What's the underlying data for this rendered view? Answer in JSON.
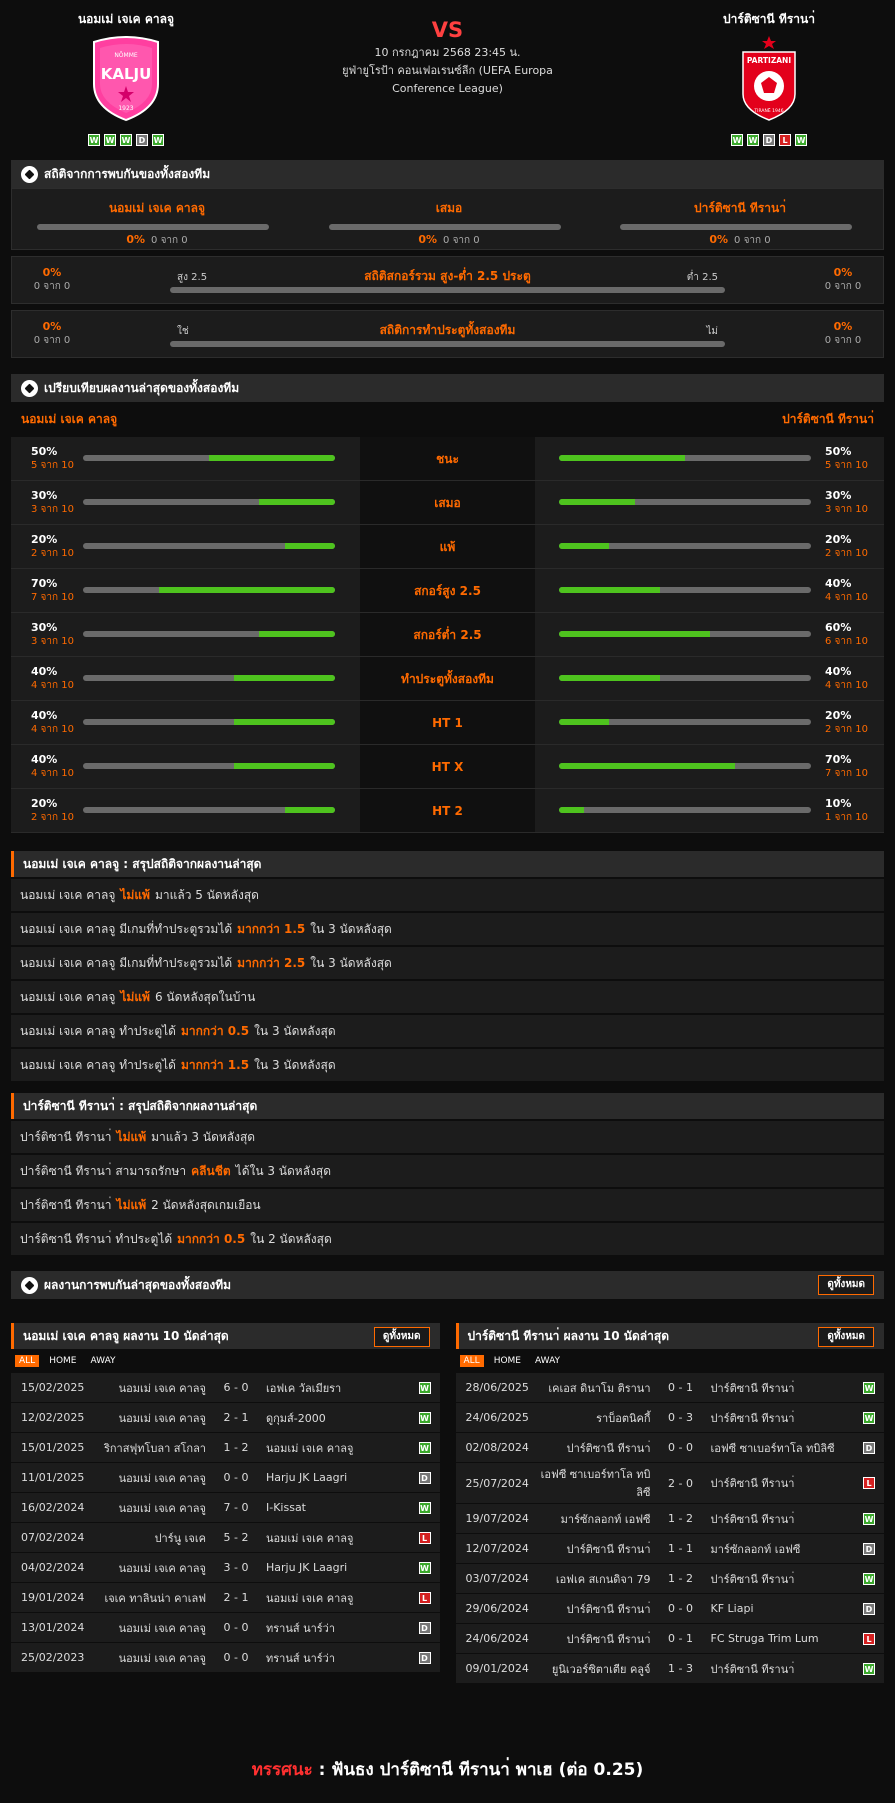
{
  "header": {
    "home_name": "นอมเม่ เจเค คาลจู",
    "away_name": "ปาร์ติซานี ทีรานา่",
    "vs": "VS",
    "match_time": "10 กรกฎาคม 2568 23:45 น.",
    "competition": "ยูฟ่ายูโรป้า คอนเฟอเรนซ์ลีก (UEFA Europa Conference League)",
    "home_form": [
      "W",
      "W",
      "W",
      "D",
      "W"
    ],
    "away_form": [
      "W",
      "W",
      "D",
      "L",
      "W"
    ],
    "home_logo_text": "KALJU",
    "home_logo_top": "NÕMME",
    "home_logo_year": "1923",
    "away_logo_text": "PARTIZANI",
    "away_logo_bottom": "TIRANË 1946"
  },
  "h2h": {
    "title": "สถิติจากการพบกันของทั้งสองทีม",
    "cols": [
      {
        "name": "นอมเม่ เจเค คาลจู",
        "pct": "0%",
        "sub": "0 จาก 0",
        "fill": 0
      },
      {
        "name": "เสมอ",
        "pct": "0%",
        "sub": "0 จาก 0",
        "fill": 0
      },
      {
        "name": "ปาร์ติซานี ทีรานา่",
        "pct": "0%",
        "sub": "0 จาก 0",
        "fill": 0
      }
    ],
    "ou": {
      "title": "สถิติสกอร์รวม สูง-ต่ำ 2.5 ประตู",
      "left_label": "สูง 2.5",
      "right_label": "ต่ำ 2.5",
      "left_pct": "0%",
      "left_sub": "0 จาก 0",
      "right_pct": "0%",
      "right_sub": "0 จาก 0"
    },
    "btts": {
      "title": "สถิติการทำประตูทั้งสองทีม",
      "left_label": "ใช่",
      "right_label": "ไม่",
      "left_pct": "0%",
      "left_sub": "0 จาก 0",
      "right_pct": "0%",
      "right_sub": "0 จาก 0"
    }
  },
  "compare": {
    "title": "เปรียบเทียบผลงานล่าสุดของทั้งสองทีม",
    "home": "นอมเม่ เจเค คาลจู",
    "away": "ปาร์ติซานี ทีรานา่",
    "rows": [
      {
        "label": "ชนะ",
        "hp": "50%",
        "hs": "5 จาก 10",
        "hf": 0.5,
        "ap": "50%",
        "as": "5 จาก 10",
        "af": 0.5
      },
      {
        "label": "เสมอ",
        "hp": "30%",
        "hs": "3 จาก 10",
        "hf": 0.3,
        "ap": "30%",
        "as": "3 จาก 10",
        "af": 0.3
      },
      {
        "label": "แพ้",
        "hp": "20%",
        "hs": "2 จาก 10",
        "hf": 0.2,
        "ap": "20%",
        "as": "2 จาก 10",
        "af": 0.2
      },
      {
        "label": "สกอร์สูง 2.5",
        "hp": "70%",
        "hs": "7 จาก 10",
        "hf": 0.7,
        "ap": "40%",
        "as": "4 จาก 10",
        "af": 0.4
      },
      {
        "label": "สกอร์ต่ำ 2.5",
        "hp": "30%",
        "hs": "3 จาก 10",
        "hf": 0.3,
        "ap": "60%",
        "as": "6 จาก 10",
        "af": 0.6
      },
      {
        "label": "ทำประตูทั้งสองทีม",
        "hp": "40%",
        "hs": "4 จาก 10",
        "hf": 0.4,
        "ap": "40%",
        "as": "4 จาก 10",
        "af": 0.4
      },
      {
        "label": "HT 1",
        "hp": "40%",
        "hs": "4 จาก 10",
        "hf": 0.4,
        "ap": "20%",
        "as": "2 จาก 10",
        "af": 0.2
      },
      {
        "label": "HT X",
        "hp": "40%",
        "hs": "4 จาก 10",
        "hf": 0.4,
        "ap": "70%",
        "as": "7 จาก 10",
        "af": 0.7
      },
      {
        "label": "HT 2",
        "hp": "20%",
        "hs": "2 จาก 10",
        "hf": 0.2,
        "ap": "10%",
        "as": "1 จาก 10",
        "af": 0.1
      }
    ]
  },
  "home_summary": {
    "title": "นอมเม่ เจเค คาลจู : สรุปสถิติจากผลงานล่าสุด",
    "rows": [
      [
        "นอมเม่ เจเค คาลจู",
        "ไม่แพ้",
        "มาแล้ว 5 นัดหลังสุด"
      ],
      [
        "นอมเม่ เจเค คาลจู  มีเกมที่ทำประตูรวมได้",
        "มากกว่า  1.5",
        "ใน 3 นัดหลังสุด"
      ],
      [
        "นอมเม่ เจเค คาลจู  มีเกมที่ทำประตูรวมได้",
        "มากกว่า  2.5",
        "ใน 3 นัดหลังสุด"
      ],
      [
        "นอมเม่ เจเค คาลจู",
        "ไม่แพ้",
        "6  นัดหลังสุดในบ้าน"
      ],
      [
        "นอมเม่ เจเค คาลจู  ทำประตูได้",
        "มากกว่า  0.5",
        "ใน 3 นัดหลังสุด"
      ],
      [
        "นอมเม่ เจเค คาลจู  ทำประตูได้",
        "มากกว่า  1.5",
        "ใน 3 นัดหลังสุด"
      ]
    ]
  },
  "away_summary": {
    "title": "ปาร์ติซานี ทีรานา่ : สรุปสถิติจากผลงานล่าสุด",
    "rows": [
      [
        "ปาร์ติซานี ทีรานา่",
        "ไม่แพ้",
        "มาแล้ว 3 นัดหลังสุด"
      ],
      [
        "ปาร์ติซานี ทีรานา่  สามารถรักษา",
        "คลีนชีต",
        "ได้ใน 3 นัดหลังสุด"
      ],
      [
        "ปาร์ติซานี ทีรานา่",
        "ไม่แพ้",
        "2  นัดหลังสุดเกมเยือน"
      ],
      [
        "ปาร์ติซานี ทีรานา่  ทำประตูได้",
        "มากกว่า  0.5",
        "ใน 2 นัดหลังสุด"
      ]
    ]
  },
  "recent": {
    "title": "ผลงานการพบกันล่าสุดของทั้งสองทีม",
    "see_all": "ดูทั้งหมด",
    "filters": [
      "ALL",
      "HOME",
      "AWAY"
    ],
    "home": {
      "title": "นอมเม่ เจเค คาลจู ผลงาน 10 นัดล่าสุด",
      "matches": [
        [
          "15/02/2025",
          "นอมเม่ เจเค คาลจู",
          "6 - 0",
          "เอฟเค วัลเมียรา",
          "W"
        ],
        [
          "12/02/2025",
          "นอมเม่ เจเค คาลจู",
          "2 - 1",
          "ดูกุมส์-2000",
          "W"
        ],
        [
          "15/01/2025",
          "ริกาสฟุทโบลา สโกลา",
          "1 - 2",
          "นอมเม่ เจเค คาลจู",
          "W"
        ],
        [
          "11/01/2025",
          "นอมเม่ เจเค คาลจู",
          "0 - 0",
          "Harju JK Laagri",
          "D"
        ],
        [
          "16/02/2024",
          "นอมเม่ เจเค คาลจู",
          "7 - 0",
          "I-Kissat",
          "W"
        ],
        [
          "07/02/2024",
          "ปาร์นู เจเค",
          "5 - 2",
          "นอมเม่ เจเค คาลจู",
          "L"
        ],
        [
          "04/02/2024",
          "นอมเม่ เจเค คาลจู",
          "3 - 0",
          "Harju JK Laagri",
          "W"
        ],
        [
          "19/01/2024",
          "เจเค ทาลินน่า คาเลฟ",
          "2 - 1",
          "นอมเม่ เจเค คาลจู",
          "L"
        ],
        [
          "13/01/2024",
          "นอมเม่ เจเค คาลจู",
          "0 - 0",
          "ทรานส์ นาร์ว่า",
          "D"
        ],
        [
          "25/02/2023",
          "นอมเม่ เจเค คาลจู",
          "0 - 0",
          "ทรานส์ นาร์ว่า",
          "D"
        ]
      ]
    },
    "away": {
      "title": "ปาร์ติซานี ทีรานา่ ผลงาน 10 นัดล่าสุด",
      "matches": [
        [
          "28/06/2025",
          "เคเอส ดินาโม ติรานา",
          "0 - 1",
          "ปาร์ติซานี ทีรานา่",
          "W"
        ],
        [
          "24/06/2025",
          "ราบ็อตนิคกี้",
          "0 - 3",
          "ปาร์ติซานี ทีรานา่",
          "W"
        ],
        [
          "02/08/2024",
          "ปาร์ติซานี ทีรานา่",
          "0 - 0",
          "เอฟซี ซาเบอร์ทาโล ทบิลิซี",
          "D"
        ],
        [
          "25/07/2024",
          "เอฟซี ซาเบอร์ทาโล ทบิลิซี",
          "2 - 0",
          "ปาร์ติซานี ทีรานา่",
          "L"
        ],
        [
          "19/07/2024",
          "มาร์ซักลอกท์ เอฟซี",
          "1 - 2",
          "ปาร์ติซานี ทีรานา่",
          "W"
        ],
        [
          "12/07/2024",
          "ปาร์ติซานี ทีรานา่",
          "1 - 1",
          "มาร์ซักลอกท์ เอฟซี",
          "D"
        ],
        [
          "03/07/2024",
          "เอฟเค สเกนดิจา 79",
          "1 - 2",
          "ปาร์ติซานี ทีรานา่",
          "W"
        ],
        [
          "29/06/2024",
          "ปาร์ติซานี ทีรานา่",
          "0 - 0",
          "KF Liapi",
          "D"
        ],
        [
          "24/06/2024",
          "ปาร์ติซานี ทีรานา่",
          "0 - 1",
          "FC Struga Trim Lum",
          "L"
        ],
        [
          "09/01/2024",
          "ยูนิเวอร์ซิตาเตีย คลูจ์",
          "1 - 3",
          "ปาร์ติซานี ทีรานา่",
          "W"
        ]
      ]
    }
  },
  "advice": {
    "label": "ทรรศนะ",
    "sep": ":",
    "text": "ฟันธง ปาร์ติซานี ทีรานา่ พาเฮ (ต่อ 0.25)"
  },
  "colors": {
    "accent": "#ff6a00",
    "win": "#3aa82b",
    "draw": "#777777",
    "loss": "#d42020",
    "bar_fill": "#4ec31e"
  }
}
